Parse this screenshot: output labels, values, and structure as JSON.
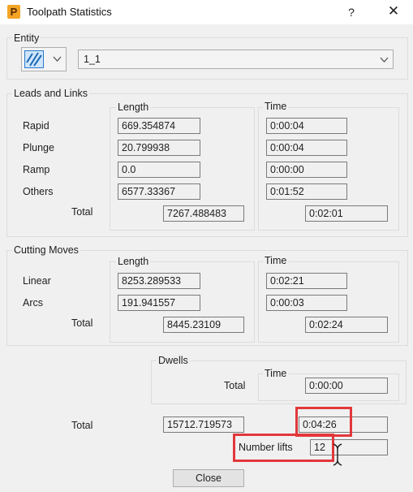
{
  "window": {
    "title": "Toolpath Statistics",
    "help": "?",
    "app_icon_letter": "P"
  },
  "entity": {
    "group_label": "Entity",
    "selected": "1_1"
  },
  "leads": {
    "group_label": "Leads and Links",
    "length_header": "Length",
    "time_header": "Time",
    "rows": [
      {
        "label": "Rapid",
        "length": "669.354874",
        "time": "0:00:04"
      },
      {
        "label": "Plunge",
        "length": "20.799938",
        "time": "0:00:04"
      },
      {
        "label": "Ramp",
        "length": "0.0",
        "time": "0:00:00"
      },
      {
        "label": "Others",
        "length": "6577.33367",
        "time": "0:01:52"
      }
    ],
    "total_label": "Total",
    "total_length": "7267.488483",
    "total_time": "0:02:01"
  },
  "cutting": {
    "group_label": "Cutting Moves",
    "length_header": "Length",
    "time_header": "Time",
    "rows": [
      {
        "label": "Linear",
        "length": "8253.289533",
        "time": "0:02:21"
      },
      {
        "label": "Arcs",
        "length": "191.941557",
        "time": "0:00:03"
      }
    ],
    "total_label": "Total",
    "total_length": "8445.23109",
    "total_time": "0:02:24"
  },
  "dwells": {
    "group_label": "Dwells",
    "time_header": "Time",
    "total_label": "Total",
    "total_time": "0:00:00"
  },
  "overall": {
    "total_label": "Total",
    "total_length": "15712.719573",
    "total_time": "0:04:26"
  },
  "lifts": {
    "label": "Number lifts",
    "value": "12"
  },
  "buttons": {
    "close": "Close"
  },
  "colors": {
    "highlight": "#e2373b",
    "window_bg": "#f0f0f0"
  }
}
